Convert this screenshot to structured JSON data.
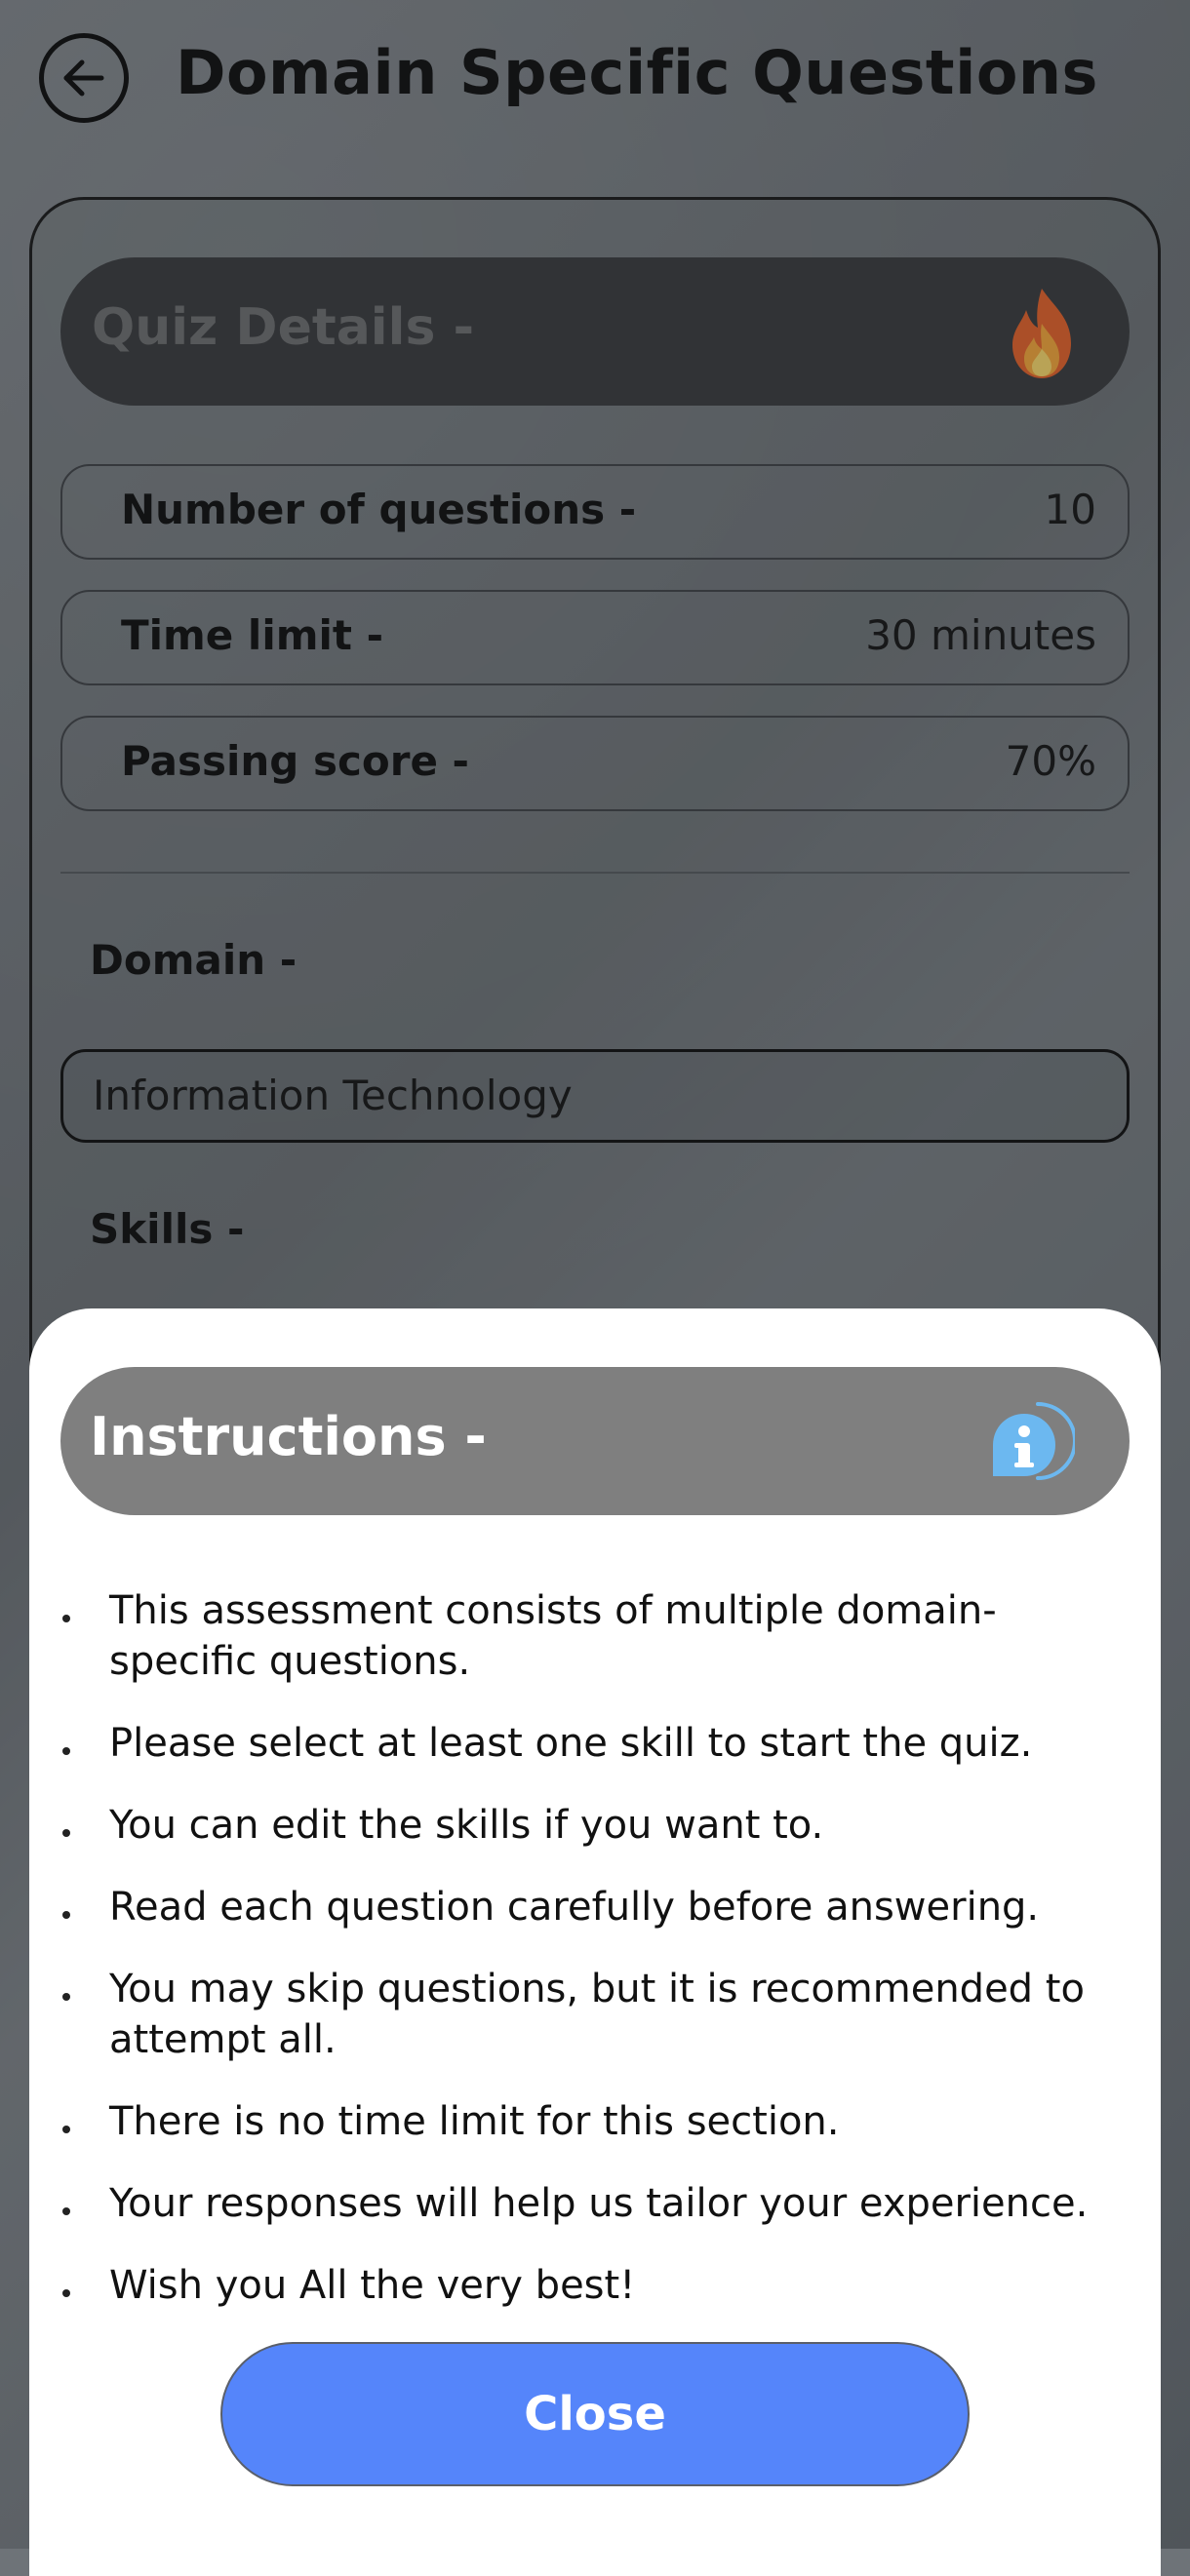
{
  "header": {
    "title": "Domain Specific Questions",
    "back_icon": "arrow-left-circle-icon"
  },
  "quiz_details": {
    "title": "Quiz Details -",
    "icon": "fire-icon",
    "rows": [
      {
        "label": "Number of questions -",
        "value": "10"
      },
      {
        "label": "Time limit -",
        "value": "30 minutes"
      },
      {
        "label": "Passing score -",
        "value": "70%"
      }
    ]
  },
  "domain": {
    "label": "Domain -",
    "value": "Information Technology"
  },
  "skills": {
    "label": "Skills -"
  },
  "instructions": {
    "title": "Instructions -",
    "icon": "info-icon",
    "icon_color": "#6cb8f0",
    "items": [
      "This assessment consists of multiple domain-specific questions.",
      "Please select at least one skill to start the quiz.",
      "You can edit the skills if you want to.",
      "Read each question carefully before answering.",
      "You may skip questions, but it is recommended to attempt all.",
      "There is no time limit for this section.",
      "Your responses will help us tailor your experience.",
      "Wish you All the very best!"
    ],
    "close_label": "Close",
    "close_color": "#5585fa"
  }
}
